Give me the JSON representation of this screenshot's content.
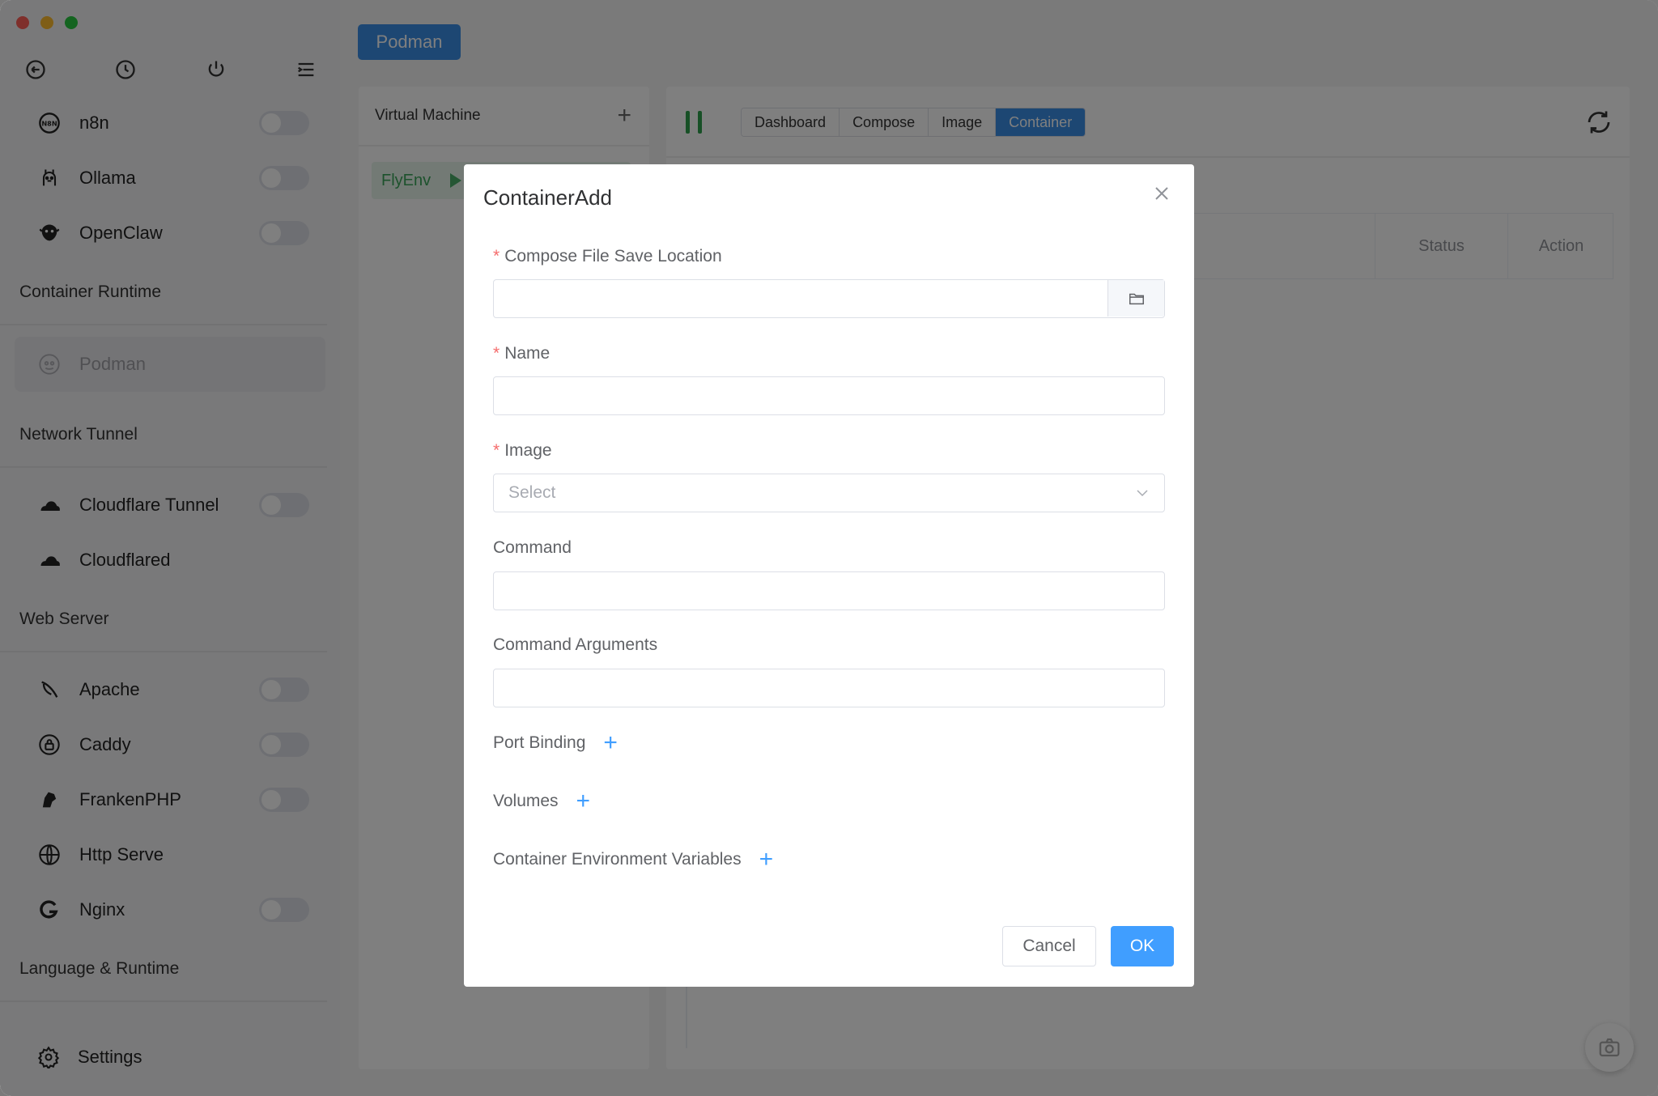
{
  "window": {
    "title": "FlyEnv"
  },
  "sidebar": {
    "top_tools": [
      {
        "name": "back-icon"
      },
      {
        "name": "history-icon"
      },
      {
        "name": "power-icon"
      },
      {
        "name": "menu-collapse-icon"
      }
    ],
    "items_top": [
      {
        "label": "n8n",
        "icon": "n8n-icon",
        "toggle": false
      },
      {
        "label": "Ollama",
        "icon": "ollama-icon",
        "toggle": false
      },
      {
        "label": "OpenClaw",
        "icon": "openclaw-icon",
        "toggle": false
      }
    ],
    "groups": {
      "container_runtime": "Container Runtime",
      "network_tunnel": "Network Tunnel",
      "web_server": "Web Server",
      "language_runtime": "Language & Runtime"
    },
    "container_items": [
      {
        "label": "Podman",
        "icon": "podman-icon",
        "active": true
      }
    ],
    "tunnel_items": [
      {
        "label": "Cloudflare Tunnel",
        "icon": "cloudflare-icon",
        "toggle": false
      },
      {
        "label": "Cloudflared",
        "icon": "cloudflare-icon"
      }
    ],
    "web_items": [
      {
        "label": "Apache",
        "icon": "apache-feather-icon",
        "toggle": false
      },
      {
        "label": "Caddy",
        "icon": "caddy-icon",
        "toggle": false
      },
      {
        "label": "FrankenPHP",
        "icon": "frankenphp-icon",
        "toggle": false
      },
      {
        "label": "Http Serve",
        "icon": "globe-icon"
      },
      {
        "label": "Nginx",
        "icon": "nginx-icon",
        "toggle": false
      }
    ],
    "settings_label": "Settings"
  },
  "main": {
    "module_button": "Podman",
    "vm_panel": {
      "title": "Virtual Machine",
      "item": "FlyEnv"
    },
    "tabs": [
      {
        "label": "Dashboard",
        "active": false
      },
      {
        "label": "Compose",
        "active": false
      },
      {
        "label": "Image",
        "active": false
      },
      {
        "label": "Container",
        "active": true
      }
    ],
    "table": {
      "columns": [
        "Status",
        "Action"
      ]
    }
  },
  "dialog": {
    "title": "ContainerAdd",
    "fields": {
      "compose_location": {
        "label": "Compose File Save Location",
        "required": true,
        "value": ""
      },
      "name": {
        "label": "Name",
        "required": true,
        "value": ""
      },
      "image": {
        "label": "Image",
        "required": true,
        "placeholder": "Select"
      },
      "command": {
        "label": "Command",
        "value": ""
      },
      "command_args": {
        "label": "Command Arguments",
        "value": ""
      }
    },
    "adders": {
      "port_binding": "Port Binding",
      "volumes": "Volumes",
      "env_vars": "Container Environment Variables"
    },
    "buttons": {
      "cancel": "Cancel",
      "ok": "OK"
    }
  },
  "colors": {
    "primary": "#409eff",
    "module_blue": "#3a8ee6",
    "running_green": "#2fa14d",
    "required_red": "#f56c6c"
  }
}
